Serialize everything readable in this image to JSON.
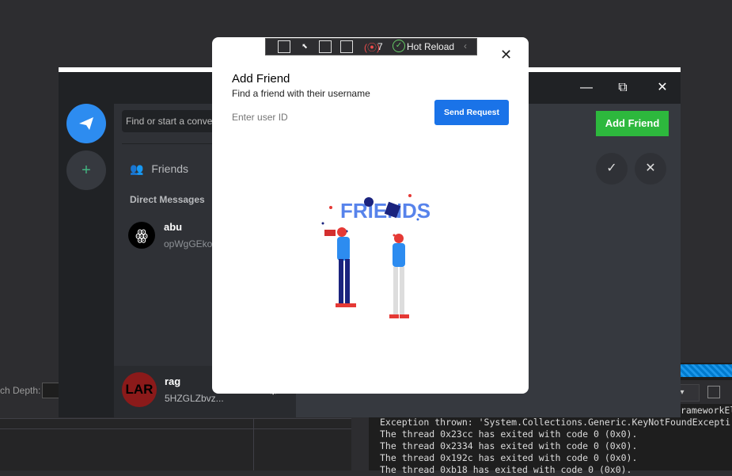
{
  "ide": {
    "search_depth_label": "ch Depth:",
    "output_combo": "",
    "output_lines": [
      "Exception thrown: 'System.Collections.Generic.KeyNotFoundExcepti",
      "The thread 0x23cc has exited with code 0 (0x0).",
      "The thread 0x2334 has exited with code 0 (0x0).",
      "The thread 0x192c has exited with code 0 (0x0).",
      "The thread 0xb18 has exited with code 0 (0x0)."
    ],
    "output_header_right": "rameworkEl"
  },
  "hot_reload": {
    "error_count": "7",
    "label": "Hot Reload"
  },
  "app": {
    "search_placeholder": "Find or start a conve",
    "friends_label": "Friends",
    "direct_messages_label": "Direct Messages",
    "dm": {
      "name": "abu",
      "id": "opWgGEko"
    },
    "user": {
      "name": "rag",
      "id": "5HZGLZbvz...",
      "avatar_text": "LAR"
    },
    "add_friend_label": "Add Friend",
    "colors": {
      "accent": "#2db83d",
      "blurple": "#2d8cf0",
      "bg": "#36393f"
    }
  },
  "modal": {
    "title": "Add Friend",
    "subtitle": "Find a friend with their username",
    "input_placeholder": "Enter user ID",
    "send_label": "Send Request",
    "illustration_text": "FRIENDS",
    "colors": {
      "primary": "#1a73e8"
    }
  }
}
